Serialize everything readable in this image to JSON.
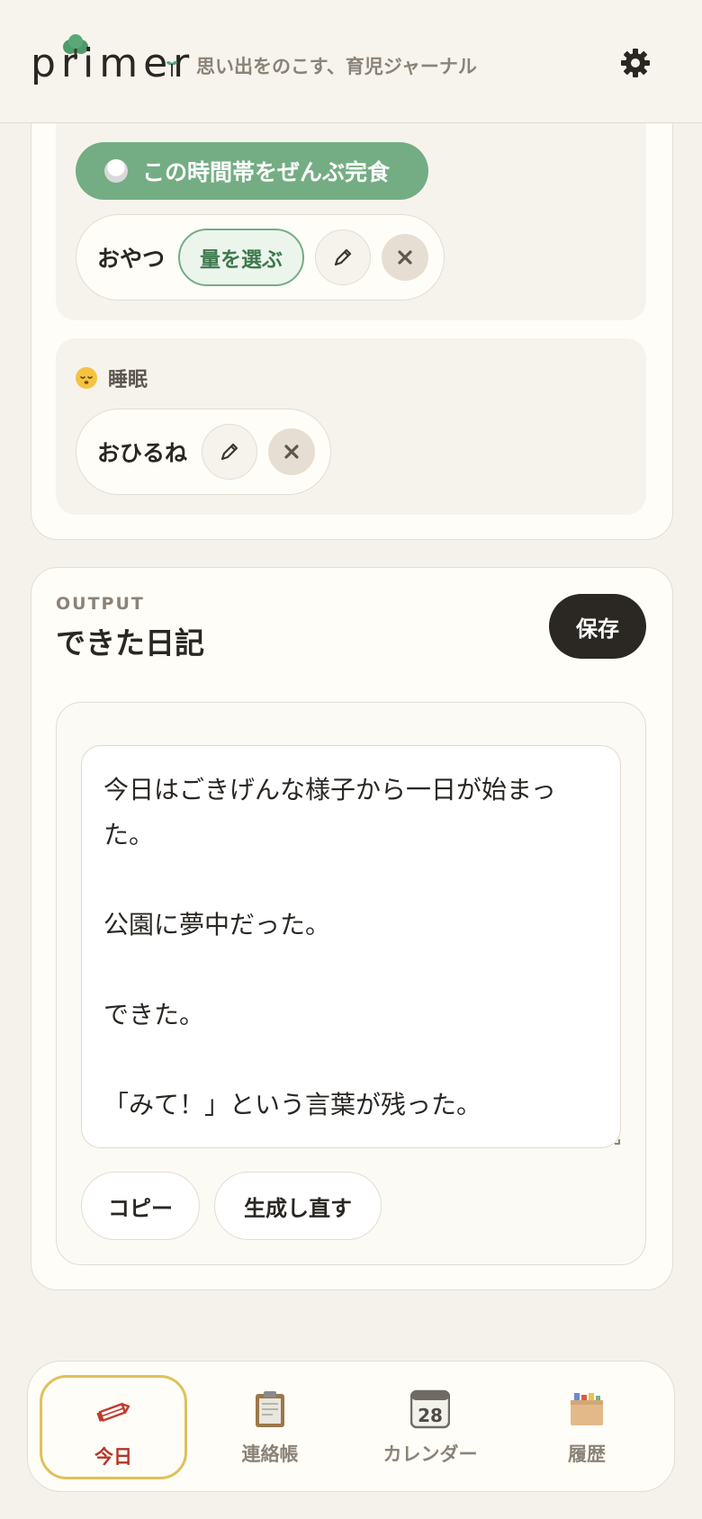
{
  "header": {
    "logo_text": "primer",
    "tagline": "思い出をのこす、育児ジャーナル",
    "settings_icon": "gear-icon"
  },
  "meal": {
    "finish_all_label": "この時間帯をぜんぶ完食",
    "finish_icon": "rice-bowl-icon",
    "items": [
      {
        "label": "おやつ",
        "amount_label": "量を選ぶ"
      }
    ]
  },
  "sleep": {
    "title": "睡眠",
    "icon": "sleeping-face-icon",
    "items": [
      {
        "label": "おひるね"
      }
    ]
  },
  "output": {
    "eyebrow": "OUTPUT",
    "title": "できた日記",
    "save_label": "保存",
    "diary_text": "今日はごきげんな様子から一日が始まった。\n\n公園に夢中だった。\n\nできた。\n\n「みて！」という言葉が残った。",
    "copy_label": "コピー",
    "regenerate_label": "生成し直す"
  },
  "nav": {
    "items": [
      {
        "label": "今日",
        "icon": "pencil-icon",
        "active": true
      },
      {
        "label": "連絡帳",
        "icon": "clipboard-icon",
        "active": false
      },
      {
        "label": "カレンダー",
        "icon": "calendar-icon",
        "calendar_day": "28",
        "active": false
      },
      {
        "label": "履歴",
        "icon": "file-box-icon",
        "active": false
      }
    ]
  },
  "colors": {
    "accent_green": "#74ad83",
    "active_nav_border": "#dfc15a",
    "active_nav_label": "#b5352a",
    "dark_button": "#2b2823"
  }
}
